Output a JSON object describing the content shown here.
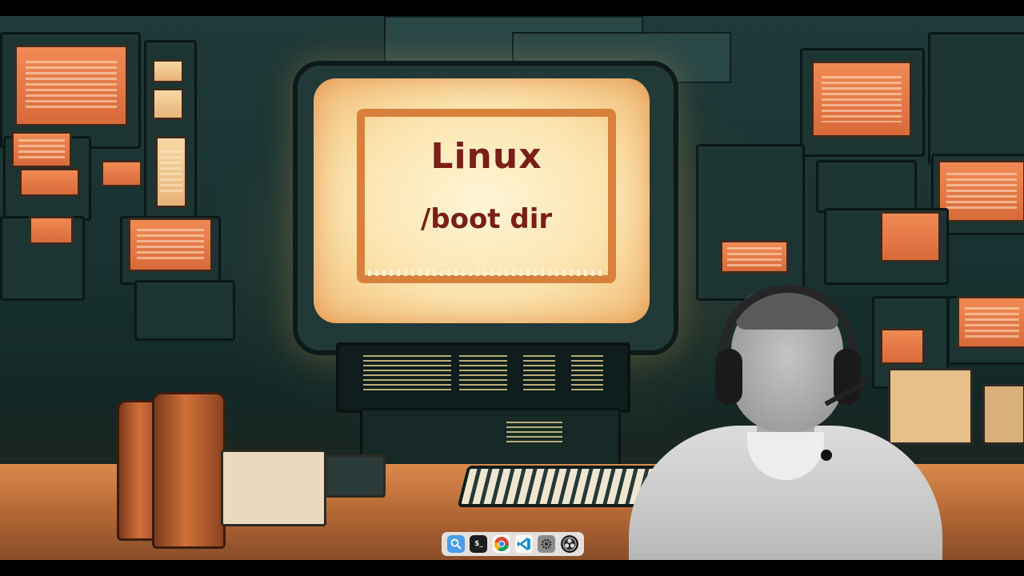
{
  "title_card": {
    "line1": "Linux",
    "line2": "/boot dir"
  },
  "dock": {
    "items": [
      {
        "icon": "finder-icon",
        "label": ""
      },
      {
        "icon": "terminal-icon",
        "label": "$_"
      },
      {
        "icon": "chrome-icon",
        "label": ""
      },
      {
        "icon": "vscode-icon",
        "label": ""
      },
      {
        "icon": "settings-icon",
        "label": ""
      },
      {
        "icon": "obs-icon",
        "label": ""
      }
    ]
  },
  "colors": {
    "screen_text": "#7a1e18",
    "accent_orange": "#d7803c",
    "room_teal": "#1f3a38"
  }
}
